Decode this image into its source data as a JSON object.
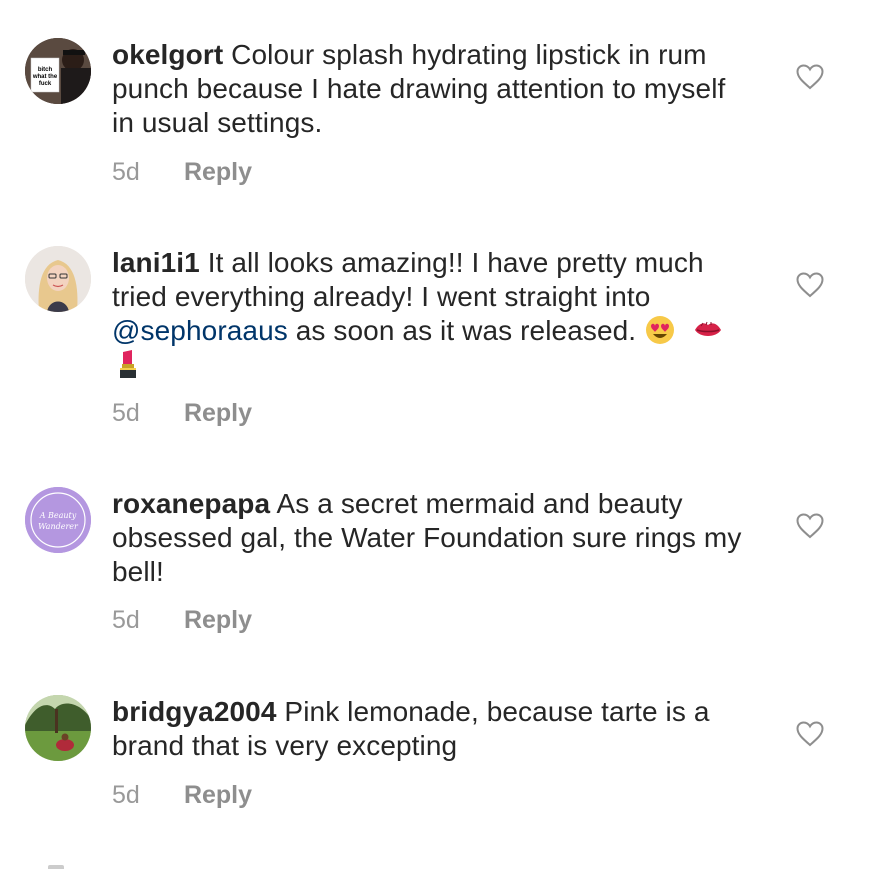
{
  "comments": [
    {
      "username": "okelgort",
      "text": "Colour splash hydrating lipstick in rum punch because I hate drawing attention to myself in usual settings.",
      "time": "5d",
      "reply_label": "Reply",
      "avatar_sign_text": "bitch what the fuck"
    },
    {
      "username": "lani1i1",
      "text_before": "It all looks amazing!! I have pretty much tried everything already! I went straight into",
      "mention": "@sephoraaus",
      "text_after": "as soon as it was released.",
      "time": "5d",
      "reply_label": "Reply",
      "emojis": [
        "heart-eyes-emoji",
        "kiss-mark-emoji",
        "lipstick-emoji"
      ]
    },
    {
      "username": "roxanepapa",
      "text": "As a secret mermaid and beauty obsessed gal, the Water Foundation sure rings my bell!",
      "time": "5d",
      "reply_label": "Reply",
      "avatar_text": "A Beauty Wanderer"
    },
    {
      "username": "bridgya2004",
      "text": "Pink lemonade, because tarte is a brand that is very excepting",
      "time": "5d",
      "reply_label": "Reply"
    }
  ],
  "colors": {
    "text": "#262626",
    "meta": "#999999",
    "mention": "#003569",
    "heart_stroke": "#8e8e8e"
  }
}
